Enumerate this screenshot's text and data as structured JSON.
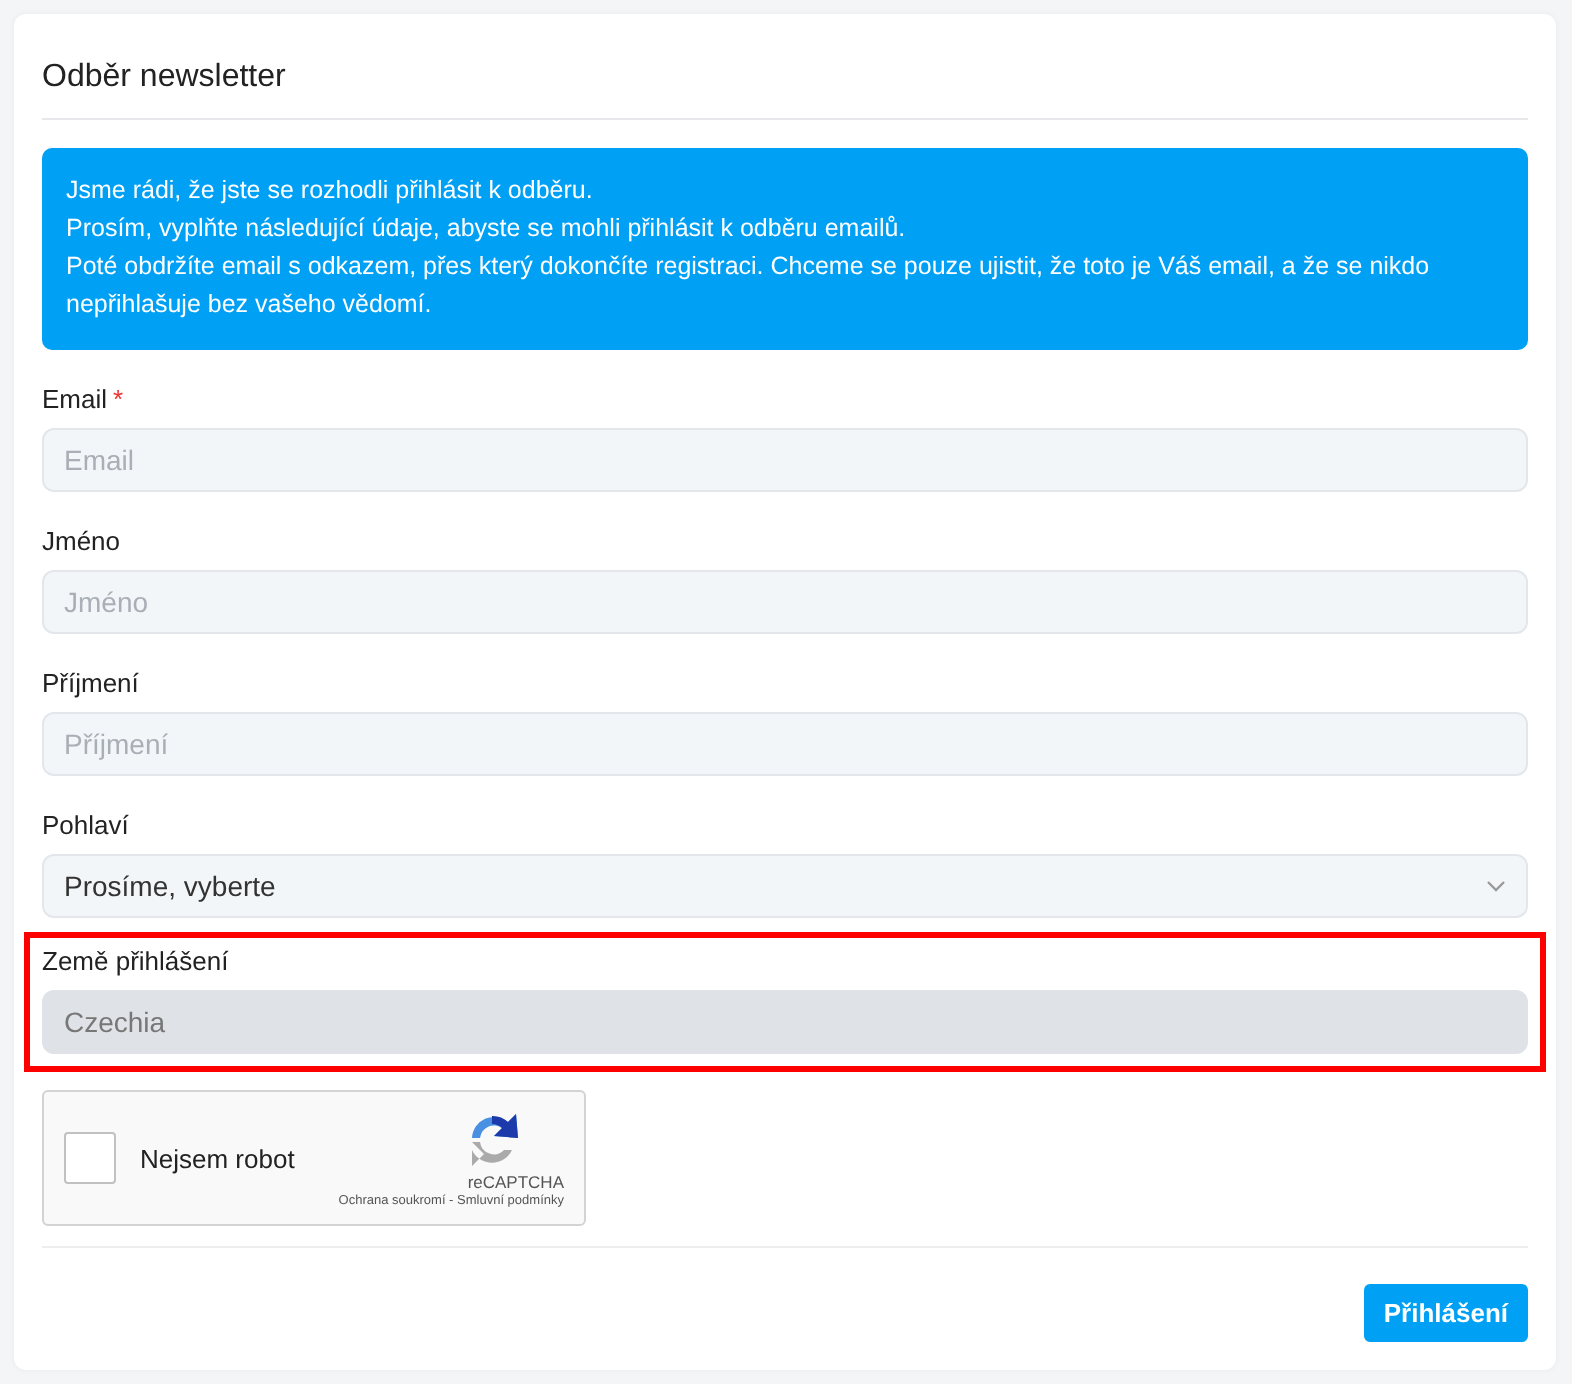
{
  "card": {
    "title": "Odběr newsletter"
  },
  "alert": {
    "lines": [
      "Jsme rádi, že jste se rozhodli přihlásit k odběru.",
      "Prosím, vyplňte následující údaje, abyste se mohli přihlásit k odběru emailů.",
      "Poté obdržíte email s odkazem, přes který dokončíte registraci. Chceme se pouze ujistit, že toto je Váš email, a že se nikdo nepřihlašuje bez vašeho vědomí."
    ]
  },
  "fields": [
    {
      "kind": "text",
      "label": "Email",
      "required_mark": "*",
      "placeholder": "Email",
      "highlighted": false
    },
    {
      "kind": "text",
      "label": "Jméno",
      "placeholder": "Jméno",
      "highlighted": false
    },
    {
      "kind": "text",
      "label": "Příjmení",
      "placeholder": "Příjmení",
      "highlighted": false
    },
    {
      "kind": "select",
      "label": "Pohlaví",
      "value": "Prosíme, vyberte",
      "highlighted": false
    },
    {
      "kind": "readonly",
      "label": "Země přihlášení",
      "value": "Czechia",
      "highlighted": true
    }
  ],
  "captcha": {
    "label": "Nejsem robot",
    "checked": false,
    "brand": "reCAPTCHA",
    "links": "Ochrana soukromí - Smluvní podmínky"
  },
  "submit": "Přihlášení"
}
